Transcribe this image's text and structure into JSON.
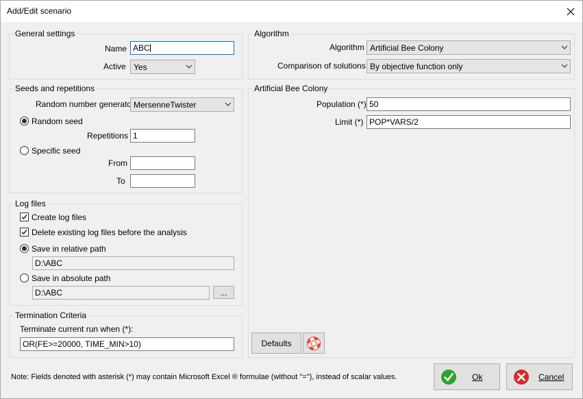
{
  "window": {
    "title": "Add/Edit scenario"
  },
  "general": {
    "title": "General settings",
    "name_label": "Name",
    "name_value": "ABC",
    "active_label": "Active",
    "active_value": "Yes"
  },
  "seeds": {
    "title": "Seeds and repetitions",
    "rng_label": "Random number generator",
    "rng_value": "MersenneTwister",
    "random_seed_label": "Random seed",
    "random_seed_selected": true,
    "repetitions_label": "Repetitions",
    "repetitions_value": "1",
    "specific_seed_label": "Specific seed",
    "from_label": "From",
    "from_value": "",
    "to_label": "To",
    "to_value": ""
  },
  "logs": {
    "title": "Log files",
    "create_label": "Create log files",
    "create_checked": true,
    "delete_label": "Delete existing log files before the analysis",
    "delete_checked": true,
    "relative_label": "Save in relative path",
    "relative_selected": true,
    "relative_path": "D:\\ABC",
    "absolute_label": "Save in absolute path",
    "absolute_path": "D:\\ABC",
    "browse_label": "..."
  },
  "termination": {
    "title": "Termination Criteria",
    "label": "Terminate current run when (*):",
    "value": "OR(FE>=20000, TIME_MIN>10)"
  },
  "algorithm": {
    "title": "Algorithm",
    "algorithm_label": "Algorithm",
    "algorithm_value": "Artificial Bee Colony",
    "comparison_label": "Comparison of solutions",
    "comparison_value": "By objective function only"
  },
  "abc": {
    "title": "Artificial Bee Colony",
    "population_label": "Population (*)",
    "population_value": "50",
    "limit_label": "Limit (*)",
    "limit_value": "POP*VARS/2",
    "defaults_label": "Defaults"
  },
  "footer": {
    "note": "Note: Fields denoted with asterisk (*) may contain Microsoft Excel ® formulae (without \"=\"), instead of scalar values.",
    "ok_label": "Ok",
    "cancel_label": "Cancel"
  },
  "colors": {
    "ok_green": "#2aa52a",
    "cancel_red": "#d92a2a",
    "help_red": "#e8442f",
    "focus_blue": "#0078d7"
  },
  "icons": {
    "close": "close-icon",
    "ok": "check-circle-icon",
    "cancel": "x-circle-icon",
    "help": "lifebuoy-icon"
  }
}
